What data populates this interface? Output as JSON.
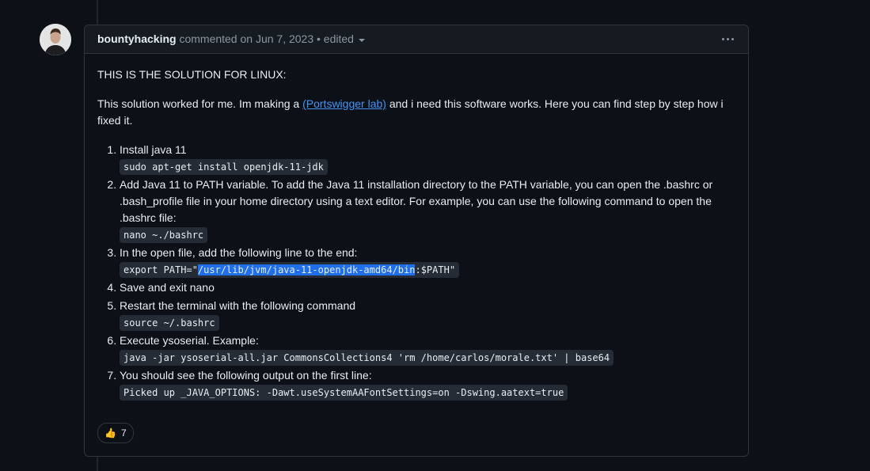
{
  "comment": {
    "author": "bountyhacking",
    "meta": "commented on Jun 7, 2023",
    "edited": "• edited",
    "intro": "THIS IS THE SOLUTION FOR LINUX:",
    "para_before_link": "This solution worked for me. Im making a ",
    "link_text": "(Portswigger lab)",
    "para_after_link": " and i need this software works. Here you can find step by step how i fixed it.",
    "steps": [
      {
        "text": "Install java 11",
        "code": "sudo apt-get install openjdk-11-jdk"
      },
      {
        "text": "Add Java 11 to PATH variable. To add the Java 11 installation directory to the PATH variable, you can open the .bashrc or .bash_profile file in your home directory using a text editor. For example, you can use the following command to open the .bashrc file:",
        "code": "nano ~./bashrc"
      },
      {
        "text": "In the open file, add the following line to the end:",
        "code_pre": "export PATH=\"",
        "code_sel": "/usr/lib/jvm/java-11-openjdk-amd64/bin",
        "code_post": ":$PATH\""
      },
      {
        "text": "Save and exit nano"
      },
      {
        "text": "Restart the terminal with the following command",
        "code": "source ~/.bashrc"
      },
      {
        "text": "Execute ysoserial. Example:",
        "code": "java -jar ysoserial-all.jar  CommonsCollections4 'rm /home/carlos/morale.txt' | base64"
      },
      {
        "text": "You should see the following output on the first line:",
        "code": "Picked up _JAVA_OPTIONS: -Dawt.useSystemAAFontSettings=on -Dswing.aatext=true"
      }
    ],
    "reaction": {
      "emoji": "👍",
      "count": "7"
    }
  },
  "icons": {
    "avatar": "avatar-photo",
    "menu": "kebab-icon",
    "dropdown": "chevron-down-icon",
    "reaction": "thumbs-up-icon"
  },
  "colors": {
    "background": "#0d1117",
    "link": "#4493f8",
    "border": "#30363d",
    "selection": "#1f6feb"
  }
}
